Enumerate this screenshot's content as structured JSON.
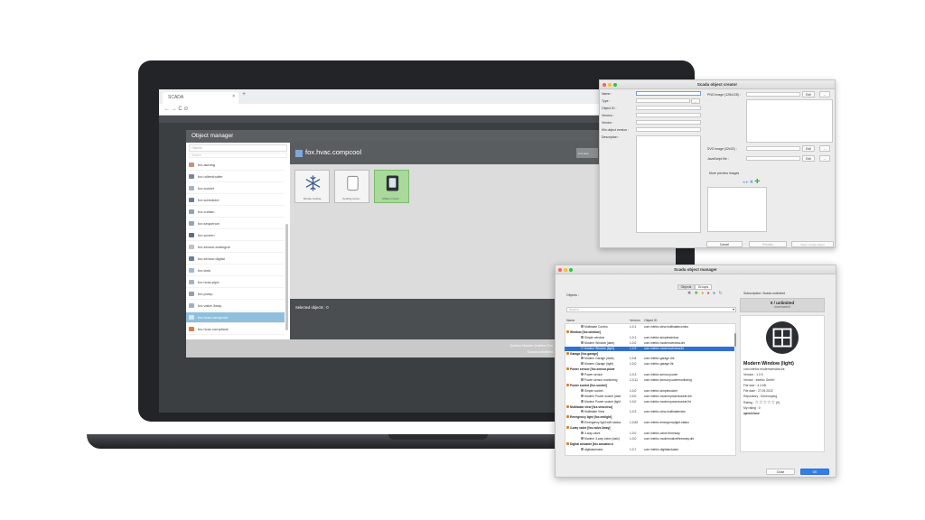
{
  "browser": {
    "tab_title": "SCADA",
    "url": "← → C ⊙"
  },
  "object_manager": {
    "title": "Object manager",
    "search_placeholder": "Objects",
    "search_placeholder_2": "Search",
    "items": [
      {
        "label": "fox.awning",
        "color": "#c98f7a"
      },
      {
        "label": "fox.rollershutter",
        "color": "#7b8793"
      },
      {
        "label": "fox.socket",
        "color": "#a9b3bd"
      },
      {
        "label": "fox.scheduler",
        "color": "#6b7d8e"
      },
      {
        "label": "fox.curtain",
        "color": "#8ea3b8"
      },
      {
        "label": "fox.sequence",
        "color": "#95a5b5"
      },
      {
        "label": "fox.screen",
        "color": "#5d6e7f"
      },
      {
        "label": "fox.sensor.analogue",
        "color": "#b6c2cc"
      },
      {
        "label": "fox.sensor.digital",
        "color": "#6f8090"
      },
      {
        "label": "fox.tank",
        "color": "#9db8cf"
      },
      {
        "label": "fox.hvac.pipe",
        "color": "#a5b4c2"
      },
      {
        "label": "fox.pump",
        "color": "#8fa2b4"
      },
      {
        "label": "fox.valve.3way",
        "color": "#9fb0c0"
      },
      {
        "label": "fox.hvac.compcool",
        "color": "#d0e8f5"
      },
      {
        "label": "fox.hvac.compheat",
        "color": "#e07b39"
      }
    ],
    "header_title": "fox.hvac.compcool",
    "header_button": "List view",
    "tiles": [
      {
        "label": "Simple cooling"
      },
      {
        "label": "Cooling comp..."
      },
      {
        "label": "Modern Cooli..."
      }
    ],
    "selected_text": "Selected objects : 0",
    "footer_line1": "Quirino Nardin (intefox Gm",
    "footer_line2": "Scada unlimited"
  },
  "creator": {
    "title": "Scada object creator",
    "fields": [
      "Name :",
      "Type :",
      "Object ID :",
      "Version :",
      "Vendor :",
      "Min object version :",
      "Description :"
    ],
    "png_label": "PNG image (128x128) :",
    "svg_label": "SVG image (32x32) :",
    "js_label": "JavaScript file :",
    "edit": "Edit",
    "dots": "...",
    "more_preview": "More preview images",
    "cancel": "Cancel",
    "preview": "Preview",
    "save": "Save / create object"
  },
  "manager": {
    "title": "Scada object manager",
    "tab_objects": "Objects",
    "tab_groups": "Groups",
    "objects_label": "Objects :",
    "search_placeholder": "Search",
    "subscription": "Subscription: Scada unlimited",
    "count": "0 / unlimited",
    "count_sub": "downloaded",
    "col_name": "Name",
    "col_version": "Version",
    "col_id": "Object ID",
    "rows": [
      {
        "name": "Multistate Combo",
        "version": "1.0.1",
        "id": "com.intefox.view.multistatecombo",
        "group": false,
        "sel": false
      },
      {
        "name": "Window [fox.window]",
        "version": "",
        "id": "",
        "group": true,
        "sel": false
      },
      {
        "name": "Simple window",
        "version": "1.0.1",
        "id": "com.intefox.simplewindow",
        "group": false,
        "sel": false
      },
      {
        "name": "Modern Window (dark)",
        "version": "1.0.0",
        "id": "com.intefox.modernwindow.drk",
        "group": false,
        "sel": false
      },
      {
        "name": "Modern Window (light)",
        "version": "1.0.9",
        "id": "com.intefox.modernwindow.lht",
        "group": false,
        "sel": true
      },
      {
        "name": "Garage [fox.garage]",
        "version": "",
        "id": "",
        "group": true,
        "sel": false
      },
      {
        "name": "Modern Garage (dark)",
        "version": "1.0.8",
        "id": "com.intefox.garage.drk",
        "group": false,
        "sel": false
      },
      {
        "name": "Modern Garage (light)",
        "version": "1.0.0",
        "id": "com.intefox.garage.lht",
        "group": false,
        "sel": false
      },
      {
        "name": "Power sensor [fox.sensor.powe",
        "version": "",
        "id": "",
        "group": true,
        "sel": false
      },
      {
        "name": "Power sensor",
        "version": "1.0.3",
        "id": "com.intefox.sensor.power",
        "group": false,
        "sel": false
      },
      {
        "name": "Power sensor monitoring",
        "version": "1.0.11",
        "id": "com.intefox.sensor.powermonitoring",
        "group": false,
        "sel": false
      },
      {
        "name": "Power socket [fox.socket]",
        "version": "",
        "id": "",
        "group": true,
        "sel": false
      },
      {
        "name": "Simple socket",
        "version": "1.0.0",
        "id": "com.intefox.simplesocket",
        "group": false,
        "sel": false
      },
      {
        "name": "Modern Power socket (dark",
        "version": "1.0.0",
        "id": "com.intefox.modernpowersocket.drk",
        "group": false,
        "sel": false
      },
      {
        "name": "Modern Power socket (light",
        "version": "1.0.0",
        "id": "com.intefox.modernpowersocket.lht",
        "group": false,
        "sel": false
      },
      {
        "name": "Multistate view [fox.view.mso]",
        "version": "",
        "id": "",
        "group": true,
        "sel": false
      },
      {
        "name": "Multistate View",
        "version": "1.0.3",
        "id": "com.intefox.view.multistateview",
        "group": false,
        "sel": false
      },
      {
        "name": "Emergency light [fox.emlight]",
        "version": "",
        "id": "",
        "group": true,
        "sel": false
      },
      {
        "name": "Emergency light with status",
        "version": "1.0.62",
        "id": "com.intefox.emergencylight.status",
        "group": false,
        "sel": false
      },
      {
        "name": "3-way valve [fox.valve.3way]",
        "version": "",
        "id": "",
        "group": true,
        "sel": false
      },
      {
        "name": "3-way valve",
        "version": "1.0.0",
        "id": "com.intefox.valve.threeway",
        "group": false,
        "sel": false
      },
      {
        "name": "Modern 3-way valve (dark)",
        "version": "1.0.0",
        "id": "com.intefox.modernvalvethreeway.drk",
        "group": false,
        "sel": false
      },
      {
        "name": "Digital actuator [fox.actuator.d",
        "version": "",
        "id": "",
        "group": true,
        "sel": false
      },
      {
        "name": "digitalactuator",
        "version": "1.0.7",
        "id": "com.intefox.digitalactuator",
        "group": false,
        "sel": false
      }
    ],
    "detail": {
      "title": "Modern Window (light)",
      "id": "com.intefox.modernwindow.lht",
      "version": "Version : 1.0.9",
      "vendor": "Vendor : Intefox GmbH",
      "file_size": "File size : 4.4 kB",
      "file_date": "File date : 27.09.2022",
      "repository": "Repository : Devenoping",
      "rating": "Rating :",
      "stars": "☆☆☆☆☆",
      "rating_count": "(0)",
      "my_rating": "My rating : 0",
      "tags": "open/close"
    },
    "close": "Close",
    "ok": "OK"
  }
}
